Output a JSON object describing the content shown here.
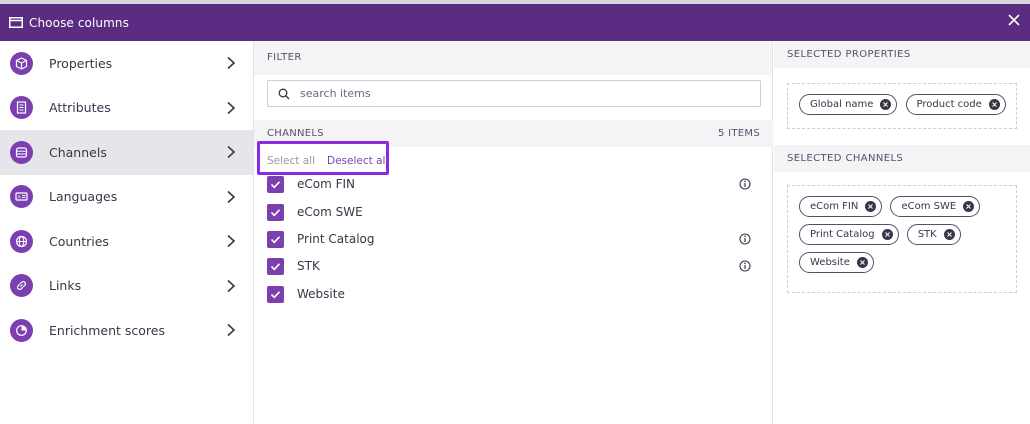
{
  "header": {
    "title": "Choose columns",
    "icon": "table-columns-icon",
    "close_icon": "close-icon",
    "bg_color": "#5a2d82"
  },
  "sidebar": {
    "items": [
      {
        "label": "Properties",
        "icon": "cube-icon",
        "active": false
      },
      {
        "label": "Attributes",
        "icon": "document-list-icon",
        "active": false
      },
      {
        "label": "Channels",
        "icon": "channels-icon",
        "active": true
      },
      {
        "label": "Languages",
        "icon": "language-icon",
        "active": false
      },
      {
        "label": "Countries",
        "icon": "globe-icon",
        "active": false
      },
      {
        "label": "Links",
        "icon": "link-icon",
        "active": false
      },
      {
        "label": "Enrichment scores",
        "icon": "pie-chart-icon",
        "active": false
      }
    ],
    "accent_color": "#7b3fb0"
  },
  "filter": {
    "heading": "FILTER",
    "search": {
      "placeholder": "search items",
      "value": ""
    },
    "channels_heading": "CHANNELS",
    "count_label": "5 ITEMS",
    "select_all": "Select all",
    "deselect_all": "Deselect all",
    "items": [
      {
        "label": "eCom FIN",
        "checked": true,
        "info": true
      },
      {
        "label": "eCom SWE",
        "checked": true,
        "info": false
      },
      {
        "label": "Print Catalog",
        "checked": true,
        "info": true
      },
      {
        "label": "STK",
        "checked": true,
        "info": true
      },
      {
        "label": "Website",
        "checked": true,
        "info": false
      }
    ]
  },
  "selected": {
    "properties_heading": "SELECTED PROPERTIES",
    "properties": [
      "Global name",
      "Product code"
    ],
    "channels_heading": "SELECTED CHANNELS",
    "channels": [
      "eCom FIN",
      "eCom SWE",
      "Print Catalog",
      "STK",
      "Website"
    ]
  }
}
